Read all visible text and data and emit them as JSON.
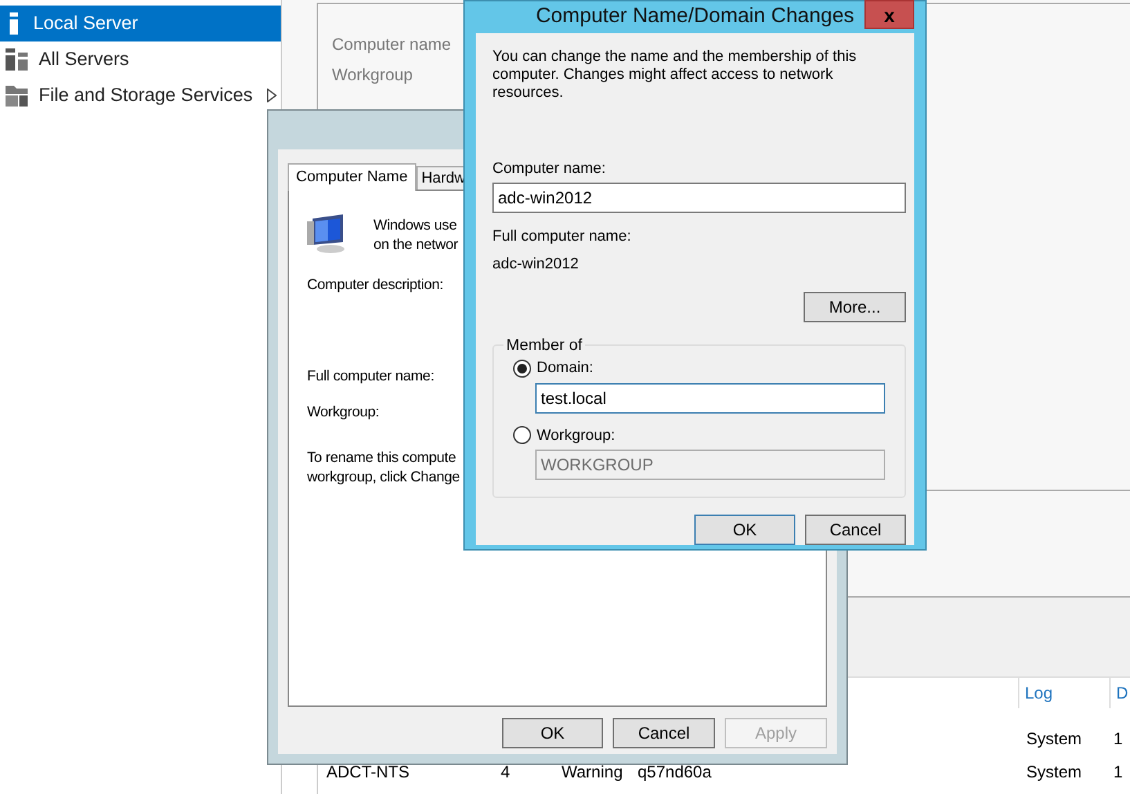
{
  "sidebar": {
    "items": [
      {
        "label": "Local Server",
        "selected": true,
        "kind": "local",
        "has_submenu": false
      },
      {
        "label": "All Servers",
        "selected": false,
        "kind": "all",
        "has_submenu": false
      },
      {
        "label": "File and Storage Services",
        "selected": false,
        "kind": "storage",
        "has_submenu": true
      }
    ]
  },
  "properties_panel": {
    "labels": [
      "Computer name",
      "Workgroup"
    ]
  },
  "events_table": {
    "columns": [
      "Log",
      "D"
    ],
    "rows": [
      {
        "log": "System",
        "d": "1"
      },
      {
        "server": "ADCT-NTS",
        "id": "4",
        "severity": "Warning",
        "source": "q57nd60a",
        "log": "System",
        "d": "1"
      }
    ]
  },
  "system_properties": {
    "tabs": [
      {
        "label": "Computer Name",
        "selected": true
      },
      {
        "label": "Hardw",
        "selected": false
      }
    ],
    "intro_lines": [
      "Windows use",
      "on the networ"
    ],
    "labels": [
      "Computer description:",
      "Full computer name:",
      "Workgroup:"
    ],
    "rename_lines": [
      "To rename this compute",
      "workgroup, click Change"
    ],
    "buttons": [
      {
        "label": "OK",
        "disabled": false
      },
      {
        "label": "Cancel",
        "disabled": false
      },
      {
        "label": "Apply",
        "disabled": true
      }
    ]
  },
  "dialog": {
    "title": "Computer Name/Domain Changes",
    "close": "x",
    "description": "You can change the name and the membership of this computer. Changes might affect access to network resources.",
    "computer_name_label": "Computer name:",
    "computer_name_value": "adc-win2012",
    "full_name_label": "Full computer name:",
    "full_name_value": "adc-win2012",
    "more_button": "More...",
    "member_of": {
      "legend": "Member of",
      "options": [
        {
          "label": "Domain:",
          "selected": true,
          "value": "test.local",
          "disabled": false
        },
        {
          "label": "Workgroup:",
          "selected": false,
          "value": "WORKGROUP",
          "disabled": true
        }
      ]
    },
    "buttons": [
      {
        "label": "OK",
        "default": true
      },
      {
        "label": "Cancel",
        "default": false
      }
    ]
  }
}
